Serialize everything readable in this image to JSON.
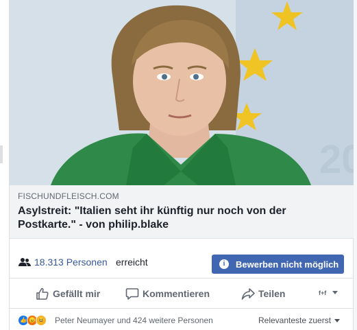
{
  "link_preview": {
    "image_alt": "Portrait of a woman in a green jacket in front of yellow stars",
    "domain": "FISCHUNDFLEISCH.COM",
    "headline": "Asylstreit: \"Italien seht ihr künftig nur noch von der Postkarte.\" - von philip.blake"
  },
  "reach": {
    "icon": "people-icon",
    "count": "18.313 Personen",
    "suffix": "erreicht",
    "boost_button": {
      "icon": "info-icon",
      "label": "Bewerben nicht möglich"
    }
  },
  "actions": {
    "like": {
      "icon": "thumbs-up-icon",
      "label": "Gefällt mir"
    },
    "comment": {
      "icon": "comment-icon",
      "label": "Kommentieren"
    },
    "share": {
      "icon": "share-arrow-icon",
      "label": "Teilen"
    },
    "page_selector": {
      "icon": "page-avatar-icon",
      "label": "f+f"
    }
  },
  "reactions": {
    "types": [
      "like",
      "angry",
      "haha"
    ],
    "summary": "Peter Neumayer und 424 weitere Personen",
    "sort_label": "Relevanteste zuerst"
  },
  "colors": {
    "accent": "#4267b2",
    "link": "#365899",
    "jacket": "#2f8a4a",
    "stars": "#f3c21b"
  }
}
